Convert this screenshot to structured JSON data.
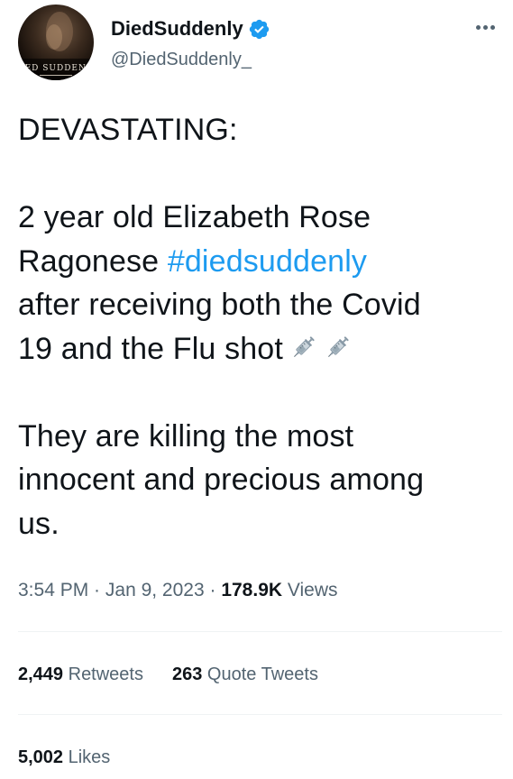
{
  "author": {
    "display_name": "DiedSuddenly",
    "handle": "@DiedSuddenly_",
    "avatar_caption": "DIED SUDDENLY",
    "verified_icon": "verified-badge-icon",
    "accent_color": "#1d9bf0"
  },
  "tweet": {
    "line_1": "DEVASTATING:",
    "line_2a": "2 year old Elizabeth Rose",
    "line_2b_prefix": "Ragonese ",
    "hashtag": "#diedsuddenly",
    "line_2c": "after receiving both the Covid",
    "line_2d": "19 and the Flu shot",
    "emoji": "syringe-icon",
    "line_3a": "They are killing the most",
    "line_3b": "innocent and precious among",
    "line_3c": "us."
  },
  "meta": {
    "time": "3:54 PM",
    "separator_1": " · ",
    "date": "Jan 9, 2023",
    "separator_2": " · ",
    "views_count": "178.9K",
    "views_label": " Views"
  },
  "stats": {
    "retweets_count": "2,449",
    "retweets_label": " Retweets",
    "quotes_count": "263",
    "quotes_label": " Quote Tweets",
    "likes_count": "5,002",
    "likes_label": " Likes"
  },
  "colors": {
    "text_primary": "#0f1419",
    "text_secondary": "#536471",
    "link": "#1d9bf0",
    "divider": "#eff3f4"
  }
}
